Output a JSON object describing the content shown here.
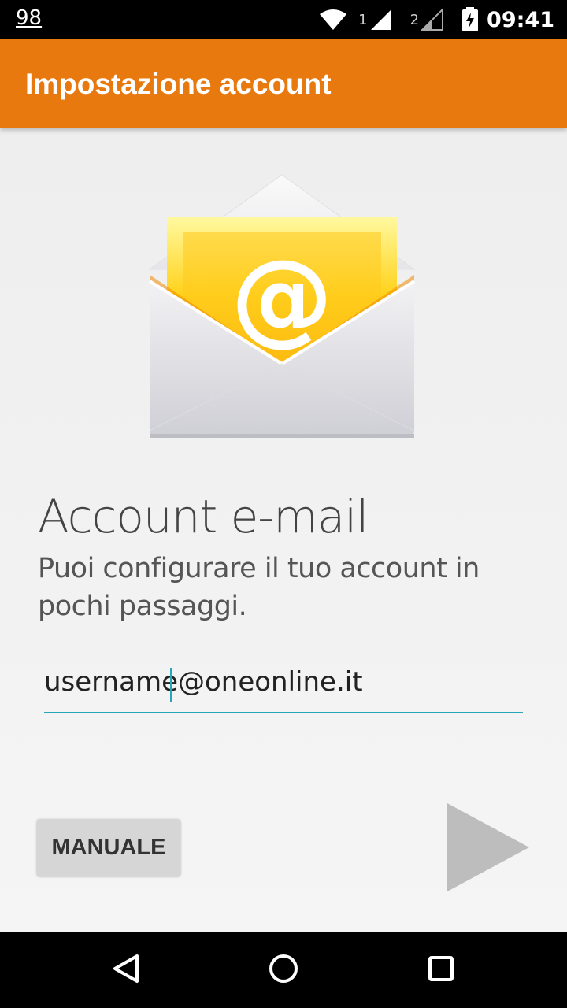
{
  "status_bar": {
    "notification_count": "98",
    "sim1_label": "1",
    "sim2_label": "2",
    "time": "09:41"
  },
  "app_bar": {
    "title": "Impostazione account"
  },
  "main": {
    "heading": "Account e-mail",
    "subtitle": "Puoi configurare il tuo account in pochi passaggi.",
    "email_value": "username@oneonline.it",
    "manual_label": "MANUALE"
  },
  "icons": {
    "envelope": "email-envelope-icon",
    "next": "next-arrow-icon"
  },
  "colors": {
    "app_bar": "#e8790f",
    "accent": "#26a7b8"
  }
}
